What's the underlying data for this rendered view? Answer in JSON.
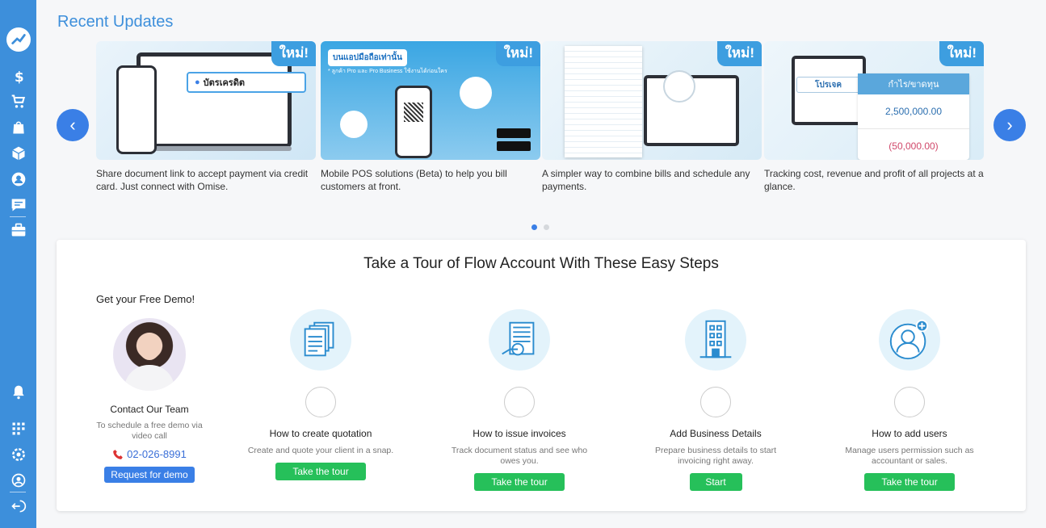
{
  "sidebar": {
    "icons": [
      "trend-logo-icon",
      "dollar-icon",
      "cart-icon",
      "shopping-bag-icon",
      "box-icon",
      "contact-icon",
      "chat-icon",
      "briefcase-icon",
      "bell-icon",
      "apps-grid-icon",
      "settings-icon",
      "user-circle-icon",
      "logout-icon"
    ]
  },
  "recent": {
    "title": "Recent Updates",
    "prev_label": "‹",
    "next_label": "›",
    "new_tag": "ใหม่!",
    "cards": [
      {
        "caption": "Share document link to accept payment via credit card. Just connect with Omise.",
        "img_text": "บัตรเครดิต"
      },
      {
        "caption": "Mobile POS solutions (Beta) to help you bill customers at front.",
        "img_text": "บนแอปมือถือเท่านั้น",
        "img_sub": "* ลูกค้า Pro และ Pro Business ใช้งานได้ก่อนใคร"
      },
      {
        "caption": "A simpler way to combine bills and schedule any payments.",
        "img_text": ""
      },
      {
        "caption": "Tracking cost, revenue and profit of all projects at a glance.",
        "img_text": "กำไร/ขาดทุน",
        "img_chip": "โปรเจค",
        "img_val1": "2,500,000.00",
        "img_val2": "(50,000.00)"
      }
    ],
    "page_count": 2,
    "active_page": 1
  },
  "tour": {
    "title": "Take a Tour of Flow Account With These Easy Steps",
    "demo": {
      "heading": "Get your Free Demo!",
      "name": "Contact Our Team",
      "desc": "To schedule a free demo via video call",
      "phone": "02-026-8991",
      "button": "Request for demo"
    },
    "steps": [
      {
        "title": "How to create quotation",
        "desc": "Create and quote your client in a snap.",
        "button": "Take the tour",
        "icon": "quotation-icon"
      },
      {
        "title": "How to issue invoices",
        "desc": "Track document status and see who owes you.",
        "button": "Take the tour",
        "icon": "invoice-icon"
      },
      {
        "title": "Add Business Details",
        "desc": "Prepare business details to start invoicing right away.",
        "button": "Start",
        "icon": "building-icon"
      },
      {
        "title": "How to add users",
        "desc": "Manage users permission such as accountant or sales.",
        "button": "Take the tour",
        "icon": "add-user-icon"
      }
    ]
  },
  "colors": {
    "sidebar": "#3d8fdb",
    "accent": "#3a7fe6",
    "green": "#26c05a"
  }
}
